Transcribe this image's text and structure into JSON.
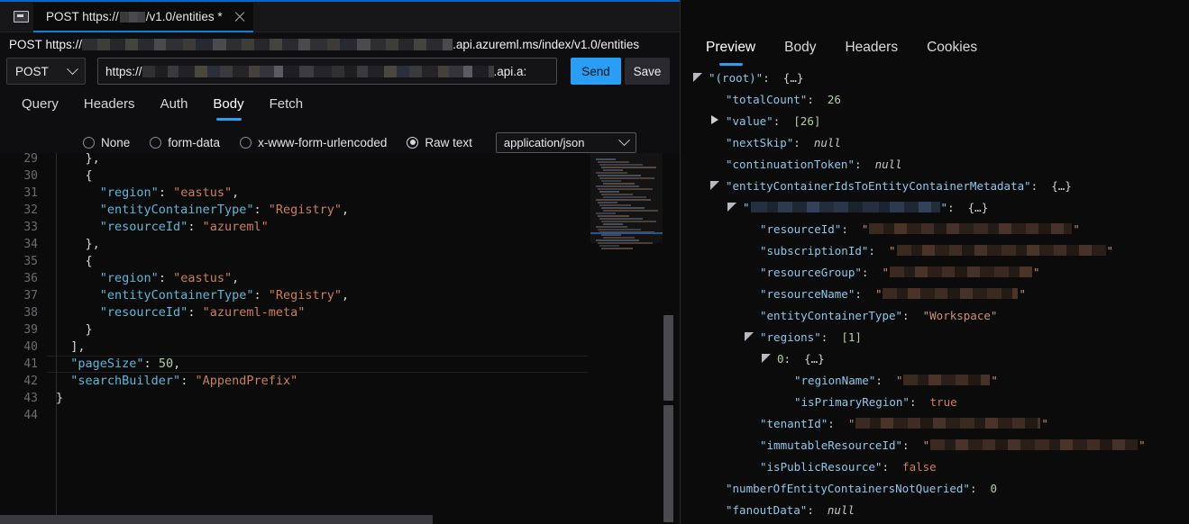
{
  "window": {
    "sidebar_toggle_tooltip": "Toggle sidebar",
    "accent": "#2a9df4"
  },
  "tab": {
    "title_prefix": "POST https://",
    "title_suffix": "/v1.0/entities",
    "dirty_marker": "*",
    "close_label": "×"
  },
  "url_summary": {
    "method": "POST",
    "scheme": "https://",
    "host_suffix": ".api.azureml.ms/index/v1.0/entities"
  },
  "request": {
    "method": "POST",
    "url_scheme": "https://",
    "url_tail": ".api.a:",
    "send_label": "Send",
    "save_label": "Save",
    "tabs": [
      {
        "label": "Query",
        "active": false
      },
      {
        "label": "Headers",
        "active": false
      },
      {
        "label": "Auth",
        "active": false
      },
      {
        "label": "Body",
        "active": true
      },
      {
        "label": "Fetch",
        "active": false
      }
    ],
    "body_types": [
      {
        "label": "None",
        "selected": false
      },
      {
        "label": "form-data",
        "selected": false
      },
      {
        "label": "x-www-form-urlencoded",
        "selected": false
      },
      {
        "label": "Raw text",
        "selected": true
      }
    ],
    "mime": "application/json"
  },
  "editor": {
    "first_line": 29,
    "last_line": 44,
    "lines": [
      {
        "n": 29,
        "tokens": [
          {
            "t": "    },",
            "c": "p"
          }
        ]
      },
      {
        "n": 30,
        "tokens": [
          {
            "t": "    {",
            "c": "p"
          }
        ]
      },
      {
        "n": 31,
        "tokens": [
          {
            "t": "      ",
            "c": "p"
          },
          {
            "t": "\"region\"",
            "c": "k"
          },
          {
            "t": ": ",
            "c": "p"
          },
          {
            "t": "\"eastus\"",
            "c": "s"
          },
          {
            "t": ",",
            "c": "p"
          }
        ]
      },
      {
        "n": 32,
        "tokens": [
          {
            "t": "      ",
            "c": "p"
          },
          {
            "t": "\"entityContainerType\"",
            "c": "k"
          },
          {
            "t": ": ",
            "c": "p"
          },
          {
            "t": "\"Registry\"",
            "c": "s"
          },
          {
            "t": ",",
            "c": "p"
          }
        ]
      },
      {
        "n": 33,
        "tokens": [
          {
            "t": "      ",
            "c": "p"
          },
          {
            "t": "\"resourceId\"",
            "c": "k"
          },
          {
            "t": ": ",
            "c": "p"
          },
          {
            "t": "\"azureml\"",
            "c": "s"
          }
        ]
      },
      {
        "n": 34,
        "tokens": [
          {
            "t": "    },",
            "c": "p"
          }
        ]
      },
      {
        "n": 35,
        "tokens": [
          {
            "t": "    {",
            "c": "p"
          }
        ]
      },
      {
        "n": 36,
        "tokens": [
          {
            "t": "      ",
            "c": "p"
          },
          {
            "t": "\"region\"",
            "c": "k"
          },
          {
            "t": ": ",
            "c": "p"
          },
          {
            "t": "\"eastus\"",
            "c": "s"
          },
          {
            "t": ",",
            "c": "p"
          }
        ]
      },
      {
        "n": 37,
        "tokens": [
          {
            "t": "      ",
            "c": "p"
          },
          {
            "t": "\"entityContainerType\"",
            "c": "k"
          },
          {
            "t": ": ",
            "c": "p"
          },
          {
            "t": "\"Registry\"",
            "c": "s"
          },
          {
            "t": ",",
            "c": "p"
          }
        ]
      },
      {
        "n": 38,
        "tokens": [
          {
            "t": "      ",
            "c": "p"
          },
          {
            "t": "\"resourceId\"",
            "c": "k"
          },
          {
            "t": ": ",
            "c": "p"
          },
          {
            "t": "\"azureml-meta\"",
            "c": "s"
          }
        ]
      },
      {
        "n": 39,
        "tokens": [
          {
            "t": "    }",
            "c": "p"
          }
        ]
      },
      {
        "n": 40,
        "tokens": [
          {
            "t": "  ],",
            "c": "p"
          }
        ]
      },
      {
        "n": 41,
        "tokens": [
          {
            "t": "  ",
            "c": "p"
          },
          {
            "t": "\"pageSize\"",
            "c": "k"
          },
          {
            "t": ": ",
            "c": "p"
          },
          {
            "t": "50",
            "c": "n"
          },
          {
            "t": ",",
            "c": "p"
          }
        ]
      },
      {
        "n": 42,
        "tokens": [
          {
            "t": "  ",
            "c": "p"
          },
          {
            "t": "\"searchBuilder\"",
            "c": "k"
          },
          {
            "t": ": ",
            "c": "p"
          },
          {
            "t": "\"AppendPrefix\"",
            "c": "s"
          }
        ]
      },
      {
        "n": 43,
        "tokens": [
          {
            "t": "}",
            "c": "p"
          }
        ]
      },
      {
        "n": 44,
        "tokens": [
          {
            "t": "",
            "c": "p"
          }
        ]
      }
    ]
  },
  "response": {
    "tabs": [
      {
        "label": "Preview",
        "active": true
      },
      {
        "label": "Body",
        "active": false
      },
      {
        "label": "Headers",
        "active": false
      },
      {
        "label": "Cookies",
        "active": false
      }
    ],
    "tree": [
      {
        "indent": 0,
        "toggle": "open",
        "key": "\"(root)\"",
        "sep": ":",
        "val": "{…}",
        "kind": "obj"
      },
      {
        "indent": 1,
        "toggle": "none",
        "key": "\"totalCount\"",
        "sep": ":",
        "val": "26",
        "kind": "num"
      },
      {
        "indent": 1,
        "toggle": "closed",
        "key": "\"value\"",
        "sep": ":",
        "val": "[26]",
        "kind": "arr"
      },
      {
        "indent": 1,
        "toggle": "none",
        "key": "\"nextSkip\"",
        "sep": ":",
        "val": "null",
        "kind": "null"
      },
      {
        "indent": 1,
        "toggle": "none",
        "key": "\"continuationToken\"",
        "sep": ":",
        "val": "null",
        "kind": "null"
      },
      {
        "indent": 1,
        "toggle": "open",
        "key": "\"entityContainerIdsToEntityContainerMetadata\"",
        "sep": ":",
        "val": "{…}",
        "kind": "obj"
      },
      {
        "indent": 2,
        "toggle": "open",
        "key": "REDACTED_BLUE",
        "sep": ":",
        "val": "{…}",
        "kind": "obj",
        "redact_width": 210
      },
      {
        "indent": 3,
        "toggle": "none",
        "key": "\"resourceId\"",
        "sep": ":",
        "val": "REDACTED_BROWN",
        "kind": "str",
        "redact_width": 225
      },
      {
        "indent": 3,
        "toggle": "none",
        "key": "\"subscriptionId\"",
        "sep": ":",
        "val": "REDACTED_BROWN",
        "kind": "str",
        "redact_width": 232
      },
      {
        "indent": 3,
        "toggle": "none",
        "key": "\"resourceGroup\"",
        "sep": ":",
        "val": "REDACTED_BROWN",
        "kind": "str",
        "redact_width": 158
      },
      {
        "indent": 3,
        "toggle": "none",
        "key": "\"resourceName\"",
        "sep": ":",
        "val": "REDACTED_BROWN",
        "kind": "str",
        "redact_width": 150
      },
      {
        "indent": 3,
        "toggle": "none",
        "key": "\"entityContainerType\"",
        "sep": ":",
        "val": "\"Workspace\"",
        "kind": "str"
      },
      {
        "indent": 3,
        "toggle": "open",
        "key": "\"regions\"",
        "sep": ":",
        "val": "[1]",
        "kind": "arr"
      },
      {
        "indent": 4,
        "toggle": "open",
        "key": "0",
        "sep": ":",
        "val": "{…}",
        "kind": "obj"
      },
      {
        "indent": 5,
        "toggle": "none",
        "key": "\"regionName\"",
        "sep": ":",
        "val": "REDACTED_BROWN",
        "kind": "str",
        "redact_width": 96
      },
      {
        "indent": 5,
        "toggle": "none",
        "key": "\"isPrimaryRegion\"",
        "sep": ":",
        "val": "true",
        "kind": "bool"
      },
      {
        "indent": 3,
        "toggle": "none",
        "key": "\"tenantId\"",
        "sep": ":",
        "val": "REDACTED_BROWN",
        "kind": "str",
        "redact_width": 205
      },
      {
        "indent": 3,
        "toggle": "none",
        "key": "\"immutableResourceId\"",
        "sep": ":",
        "val": "REDACTED_BROWN",
        "kind": "str",
        "redact_width": 230
      },
      {
        "indent": 3,
        "toggle": "none",
        "key": "\"isPublicResource\"",
        "sep": ":",
        "val": "false",
        "kind": "bool"
      },
      {
        "indent": 1,
        "toggle": "none",
        "key": "\"numberOfEntityContainersNotQueried\"",
        "sep": ":",
        "val": "0",
        "kind": "num"
      },
      {
        "indent": 1,
        "toggle": "none",
        "key": "\"fanoutData\"",
        "sep": ":",
        "val": "null",
        "kind": "null"
      }
    ]
  }
}
